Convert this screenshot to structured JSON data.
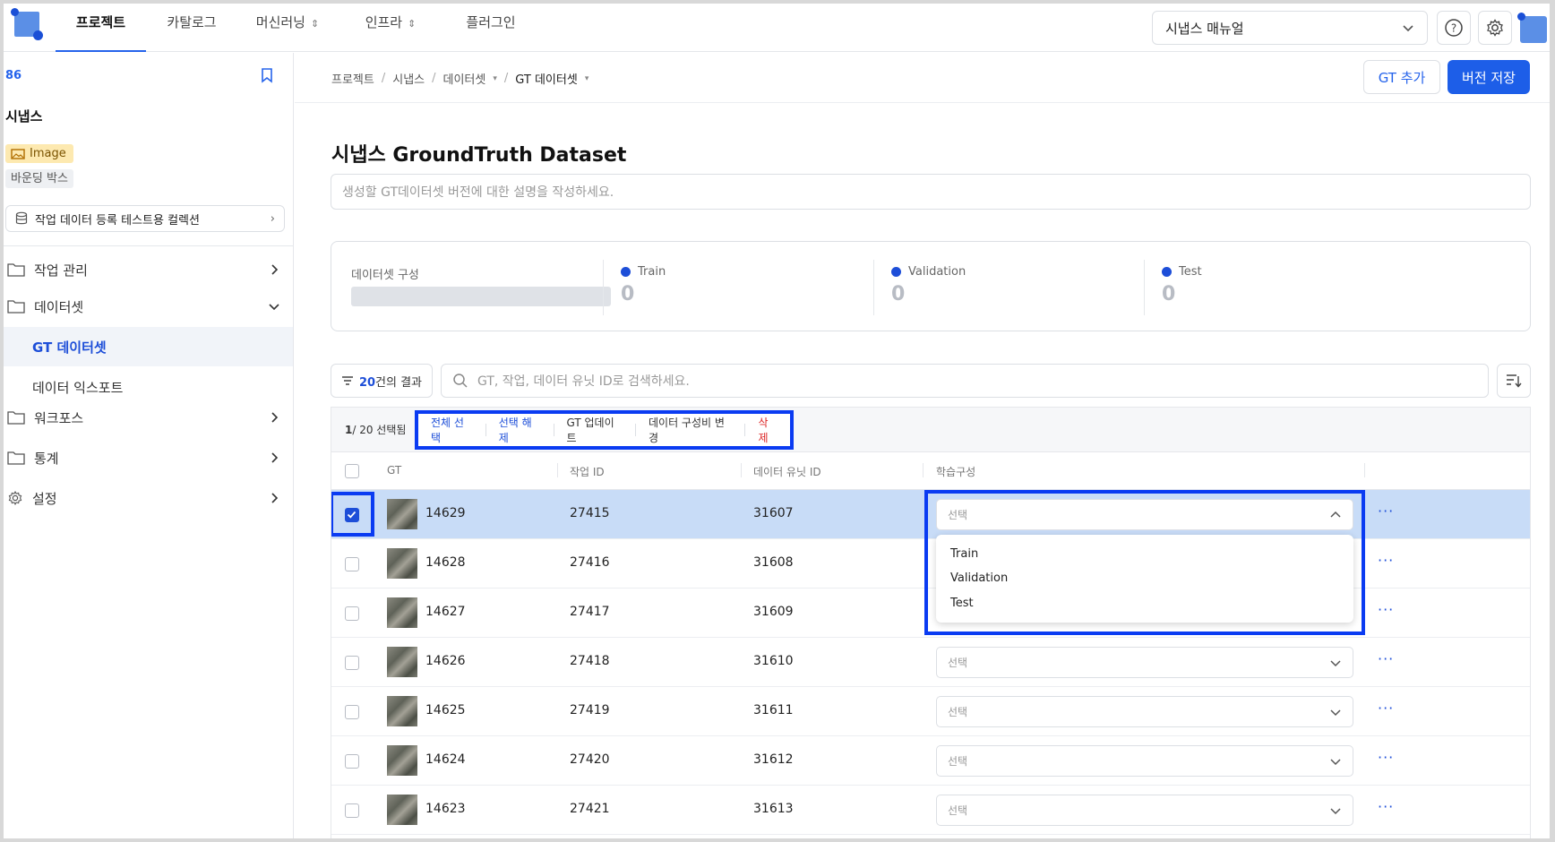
{
  "nav": {
    "tabs": [
      {
        "label": "프로젝트",
        "active": true
      },
      {
        "label": "카탈로그"
      },
      {
        "label": "머신러닝"
      },
      {
        "label": "인프라"
      },
      {
        "label": "플러그인"
      }
    ],
    "manual_select": "시냅스 매뉴얼"
  },
  "sidebar": {
    "project_id": "86",
    "project_name": "시냅스",
    "tag_image": "Image",
    "tag_bbox": "바운딩 박스",
    "collection": "작업 데이터 등록 테스트용 컬렉션",
    "items": [
      {
        "label": "작업 관리"
      },
      {
        "label": "데이터셋"
      },
      {
        "label": "GT 데이터셋",
        "active": true
      },
      {
        "label": "데이터 익스포트"
      },
      {
        "label": "워크포스"
      },
      {
        "label": "통계"
      },
      {
        "label": "설정"
      }
    ]
  },
  "breadcrumb": [
    "프로젝트",
    "시냅스",
    "데이터셋",
    "GT 데이터셋"
  ],
  "header": {
    "add_gt": "GT 추가",
    "save_version": "버전 저장"
  },
  "title": "시냅스 GroundTruth Dataset",
  "description_placeholder": "생성할 GT데이터셋 버전에 대한 설명을 작성하세요.",
  "summary": {
    "composition_label": "데이터셋 구성",
    "splits": [
      {
        "name": "Train",
        "count": "0"
      },
      {
        "name": "Validation",
        "count": "0"
      },
      {
        "name": "Test",
        "count": "0"
      }
    ]
  },
  "filter": {
    "count": "20",
    "suffix": "건의 결과"
  },
  "search_placeholder": "GT, 작업, 데이터 유닛 ID로 검색하세요.",
  "bulk": {
    "selected": "1",
    "total": "/ 20 선택됨",
    "select_all": "전체 선택",
    "deselect": "선택 해제",
    "gt_update": "GT 업데이트",
    "change_ratio": "데이터 구성비 변경",
    "delete": "삭제"
  },
  "columns": {
    "gt": "GT",
    "task_id": "작업 ID",
    "data_unit_id": "데이터 유닛 ID",
    "split": "학습구성"
  },
  "rows": [
    {
      "gt": "14629",
      "task_id": "27415",
      "data_unit_id": "31607",
      "split": "선택",
      "checked": true
    },
    {
      "gt": "14628",
      "task_id": "27416",
      "data_unit_id": "31608",
      "split": ""
    },
    {
      "gt": "14627",
      "task_id": "27417",
      "data_unit_id": "31609",
      "split": ""
    },
    {
      "gt": "14626",
      "task_id": "27418",
      "data_unit_id": "31610",
      "split": "선택"
    },
    {
      "gt": "14625",
      "task_id": "27419",
      "data_unit_id": "31611",
      "split": "선택"
    },
    {
      "gt": "14624",
      "task_id": "27420",
      "data_unit_id": "31612",
      "split": "선택"
    },
    {
      "gt": "14623",
      "task_id": "27421",
      "data_unit_id": "31613",
      "split": "선택"
    }
  ],
  "dropdown_options": [
    "Train",
    "Validation",
    "Test"
  ],
  "colors": {
    "accent": "#1d5ee8",
    "selected_row": "#c8dcf7",
    "highlight": "#0a3bf2",
    "danger": "#dc2626"
  }
}
